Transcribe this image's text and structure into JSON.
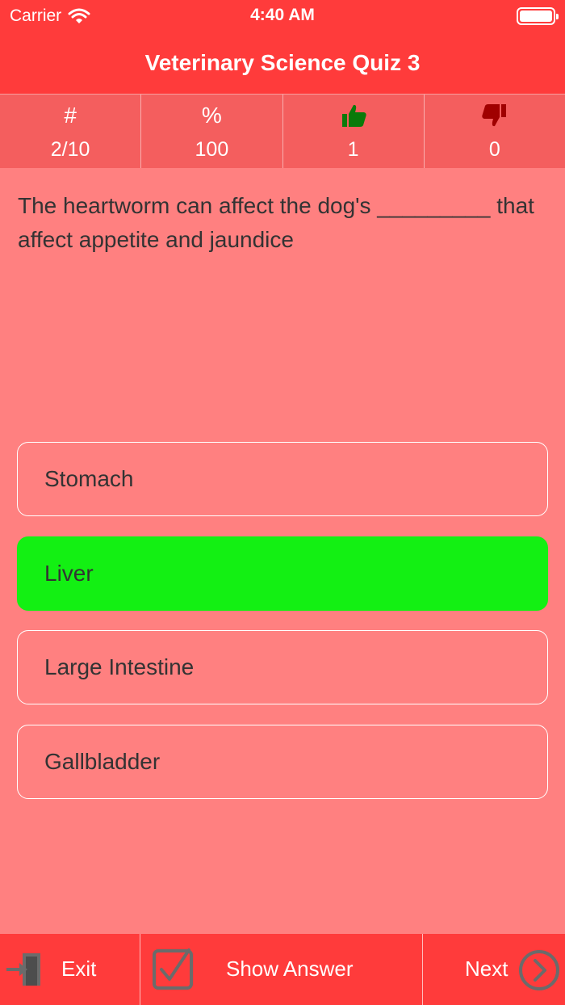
{
  "status_bar": {
    "carrier": "Carrier",
    "time": "4:40 AM"
  },
  "header": {
    "title": "Veterinary Science Quiz 3"
  },
  "stats": [
    {
      "symbol": "#",
      "value": "2/10"
    },
    {
      "symbol": "%",
      "value": "100"
    },
    {
      "symbol_icon": "thumbs-up-icon",
      "value": "1"
    },
    {
      "symbol_icon": "thumbs-down-icon",
      "value": "0"
    }
  ],
  "question": {
    "text": "The heartworm can affect the dog's _________ that affect appetite and jaundice"
  },
  "answers": [
    {
      "label": "Stomach",
      "state": "default"
    },
    {
      "label": "Liver",
      "state": "correct"
    },
    {
      "label": "Large Intestine",
      "state": "default"
    },
    {
      "label": "Gallbladder",
      "state": "default"
    }
  ],
  "bottom_bar": {
    "exit_label": "Exit",
    "show_answer_label": "Show Answer",
    "next_label": "Next"
  },
  "colors": {
    "accent": "#ff3b3b",
    "background": "#ff8080",
    "correct": "#13f013",
    "thumbs_up": "#0a7a0a",
    "thumbs_down": "#a00000"
  }
}
